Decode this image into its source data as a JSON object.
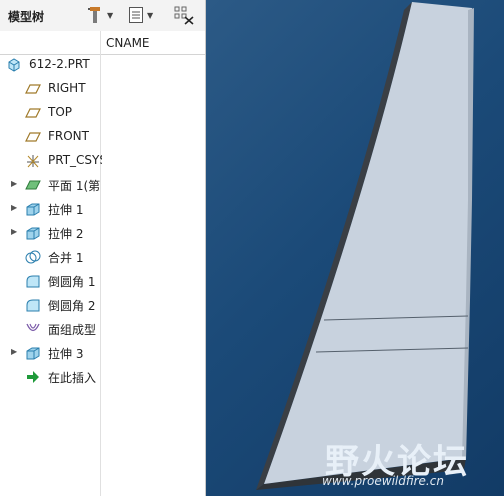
{
  "toolbar": {
    "tab_title": "模型树"
  },
  "tree": {
    "column_header": "CNAME",
    "items": [
      {
        "label": "612-2.PRT",
        "icon": "part-icon"
      },
      {
        "label": "RIGHT",
        "icon": "datum-plane-icon"
      },
      {
        "label": "TOP",
        "icon": "datum-plane-icon"
      },
      {
        "label": "FRONT",
        "icon": "datum-plane-icon"
      },
      {
        "label": "PRT_CSYS",
        "icon": "csys-icon"
      },
      {
        "label": "平面 1(第",
        "icon": "plane-feature-icon"
      },
      {
        "label": "拉伸 1",
        "icon": "extrude-icon"
      },
      {
        "label": "拉伸 2",
        "icon": "extrude-icon"
      },
      {
        "label": "合并 1",
        "icon": "merge-icon"
      },
      {
        "label": "倒圆角 1",
        "icon": "round-icon"
      },
      {
        "label": "倒圆角 2",
        "icon": "round-icon"
      },
      {
        "label": "面组成型",
        "icon": "quilt-form-icon"
      },
      {
        "label": "拉伸 3",
        "icon": "extrude-icon"
      },
      {
        "label": "在此插入",
        "icon": "insert-here-icon"
      }
    ]
  },
  "watermark": {
    "text": "野火论坛",
    "url": "www.proewildfire.cn"
  },
  "colors": {
    "viewport_bg": "#1b4a78",
    "part_surface": "#c8d2de",
    "part_edge": "#3a3f45",
    "insert_arrow": "#1f9a3a"
  }
}
